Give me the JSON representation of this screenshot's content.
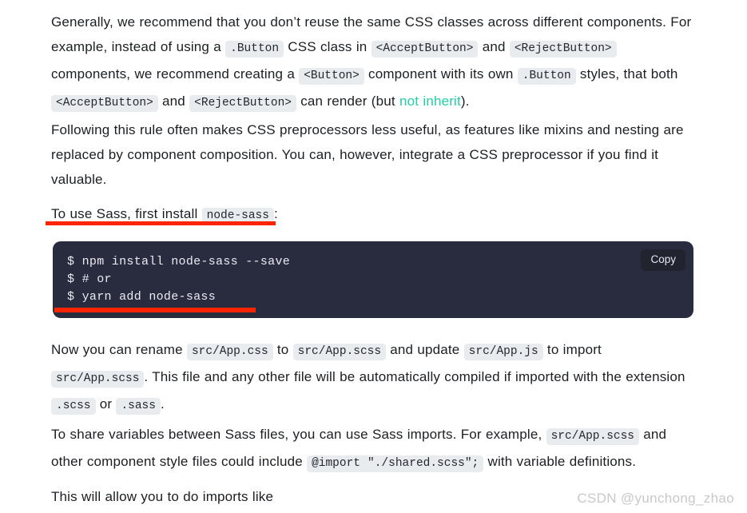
{
  "page": {
    "background_color": "#ffffff",
    "text_color": "#1c1e21",
    "link_color": "#22cfa6",
    "chip_background": "#e9ecef",
    "code_block_background": "#282c3e",
    "annotation_color": "#ff2400"
  },
  "paragraphs": {
    "p1": {
      "s1": "Generally, we recommend that you don’t reuse the same CSS classes across different components. For example, instead of using a ",
      "c1": ".Button",
      "s2": " CSS class in ",
      "c2": "<AcceptButton>",
      "s3": " and ",
      "c3": "<RejectButton>",
      "s4": " components, we recommend creating a ",
      "c4": "<Button>",
      "s5": " component with its own ",
      "c5": ".Button",
      "s6": " styles, that both ",
      "c6": "<AcceptButton>",
      "s7": " and ",
      "c7": "<RejectButton>",
      "s8": " can render (but ",
      "link": "not inherit",
      "s9": ")."
    },
    "p2": {
      "s1": "Following this rule often makes CSS preprocessors less useful, as features like mixins and nesting are replaced by component composition. You can, however, integrate a CSS preprocessor if you find it valuable."
    },
    "p3": {
      "s1": "To use Sass, first install ",
      "c1": "node-sass",
      "s2": ":"
    },
    "p4": {
      "s1": "Now you can rename ",
      "c1": "src/App.css",
      "s2": " to ",
      "c2": "src/App.scss",
      "s3": " and update ",
      "c3": "src/App.js",
      "s4": " to import ",
      "c4": "src/App.scss",
      "s5": ". This file and any other file will be automatically compiled if imported with the extension ",
      "c5": ".scss",
      "s6": " or ",
      "c6": ".sass",
      "s7": "."
    },
    "p5": {
      "s1": "To share variables between Sass files, you can use Sass imports. For example, ",
      "c1": "src/App.scss",
      "s2": " and other component style files could include ",
      "c2": "@import \"./shared.scss\";",
      "s3": " with variable definitions."
    },
    "p6": {
      "s1": "This will allow you to do imports like"
    }
  },
  "code_block": {
    "content": "$ npm install node-sass --save\n$ # or\n$ yarn add node-sass",
    "copy_label": "Copy"
  },
  "watermark": {
    "text": "CSDN @yunchong_zhao"
  }
}
